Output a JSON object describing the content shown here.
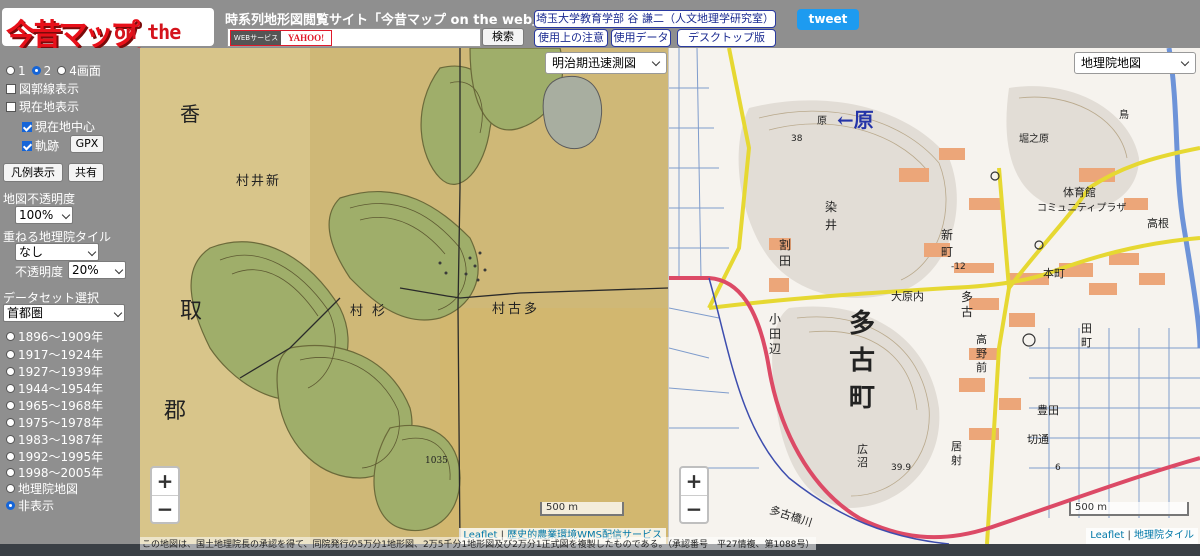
{
  "header": {
    "logo_main": "今昔マップ",
    "logo_sub": "on the web",
    "site_title": "時系列地形図閲覧サイト「今昔マップ on the web」",
    "search_badge_left": "WEBサービス",
    "search_badge_right": "YAHOO!",
    "search_value": "",
    "search_button": "検索",
    "author_link": "埼玉大学教育学部 谷 謙二（人文地理学研究室）",
    "notes_link": "使用上の注意",
    "data_link": "使用データ",
    "desktop_link": "デスクトップ版",
    "tweet_button": "tweet"
  },
  "sidebar": {
    "screen_options": [
      {
        "label": "1",
        "selected": false
      },
      {
        "label": "2",
        "selected": true
      },
      {
        "label": "4画面",
        "selected": false
      }
    ],
    "checkboxes": [
      {
        "label": "図郭線表示",
        "checked": false
      },
      {
        "label": "現在地表示",
        "checked": false
      },
      {
        "label": "現在地中心",
        "checked": true
      },
      {
        "label": "軌跡",
        "checked": true
      }
    ],
    "gpx_button": "GPX",
    "legend_button": "凡例表示",
    "share_button": "共有",
    "opacity_label": "地図不透明度",
    "opacity_value": "100%",
    "overlay_label": "重ねる地理院タイル",
    "overlay_value": "なし",
    "overlay_opacity_label": "不透明度",
    "overlay_opacity_value": "20%",
    "dataset_label": "データセット選択",
    "dataset_value": "首都圏",
    "periods": [
      {
        "label": "1896～1909年",
        "selected": false
      },
      {
        "label": "1917～1924年",
        "selected": false
      },
      {
        "label": "1927～1939年",
        "selected": false
      },
      {
        "label": "1944～1954年",
        "selected": false
      },
      {
        "label": "1965～1968年",
        "selected": false
      },
      {
        "label": "1975～1978年",
        "selected": false
      },
      {
        "label": "1983～1987年",
        "selected": false
      },
      {
        "label": "1992～1995年",
        "selected": false
      },
      {
        "label": "1998～2005年",
        "selected": false
      },
      {
        "label": "地理院地図",
        "selected": false
      },
      {
        "label": "非表示",
        "selected": true
      }
    ]
  },
  "map_left": {
    "selector": "明治期迅速測図",
    "zoom_in": "+",
    "zoom_out": "−",
    "scale": "500 m",
    "attrib_leaflet": "Leaflet",
    "attrib_sep": "|",
    "attrib_source": "歴史的農業環境WMS配信サービス",
    "labels": [
      "香",
      "取",
      "郡",
      "村井新",
      "村古多",
      "村",
      "杉",
      "1035"
    ]
  },
  "map_right": {
    "selector": "地理院地図",
    "zoom_in": "+",
    "zoom_out": "−",
    "scale": "500 m",
    "attrib_leaflet": "Leaflet",
    "attrib_sep": "|",
    "attrib_source": "地理院タイル",
    "labels": [
      "←原",
      "多",
      "古",
      "町",
      "染",
      "井",
      "新",
      "町",
      "割",
      "田",
      "小",
      "田",
      "辺",
      "大原内",
      "多",
      "古",
      "高",
      "野",
      "前",
      "本町",
      "田",
      "町",
      "豊田",
      "切通",
      "広",
      "沼",
      "居",
      "射",
      "体育館",
      "コミュニティプラザ",
      "高根",
      "堀之原",
      "鳥",
      "-12",
      "38",
      "39.9",
      "6",
      "原",
      "多古橋川"
    ]
  },
  "copyright": "この地図は、国土地理院長の承認を得て、同院発行の5万分1地形図、2万5千分1地形図及び2万分1正式図を複製したものである。（承認番号　平27情複、第1088号）"
}
